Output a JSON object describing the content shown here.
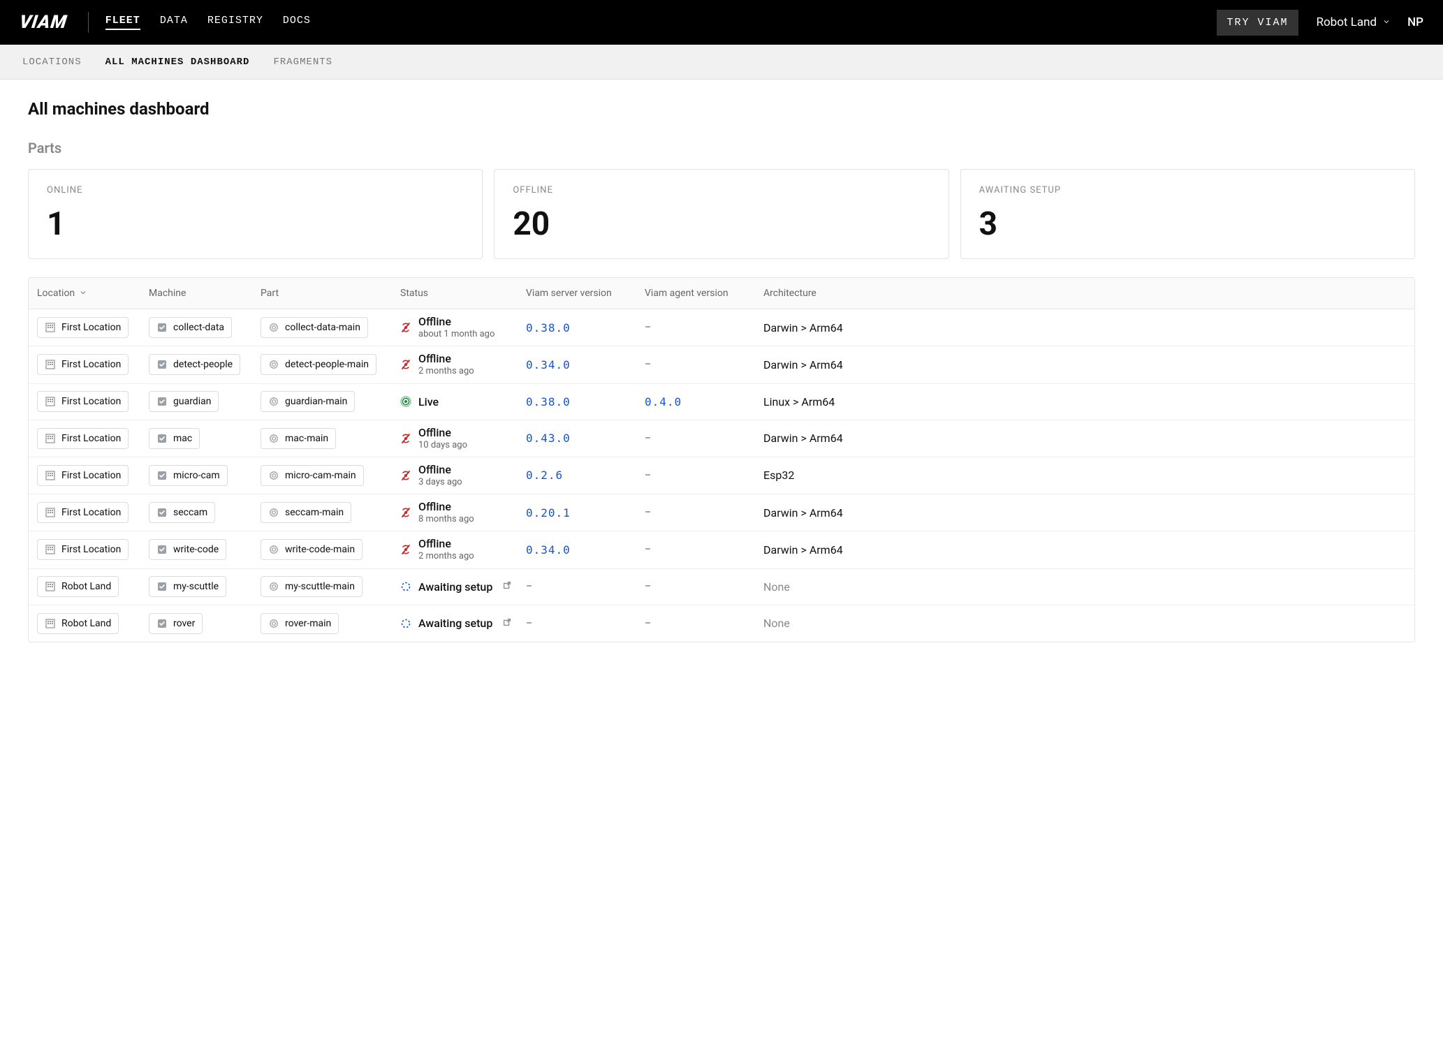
{
  "header": {
    "logo": "VIAM",
    "nav": {
      "fleet": "FLEET",
      "data": "DATA",
      "registry": "REGISTRY",
      "docs": "DOCS"
    },
    "try": "TRY VIAM",
    "org": "Robot Land",
    "user_initials": "NP"
  },
  "subnav": {
    "locations": "LOCATIONS",
    "all_machines": "ALL MACHINES DASHBOARD",
    "fragments": "FRAGMENTS"
  },
  "page": {
    "title": "All machines dashboard",
    "section": "Parts"
  },
  "stats": {
    "online_label": "ONLINE",
    "online_value": "1",
    "offline_label": "OFFLINE",
    "offline_value": "20",
    "awaiting_label": "AWAITING SETUP",
    "awaiting_value": "3"
  },
  "table": {
    "headers": {
      "location": "Location",
      "machine": "Machine",
      "part": "Part",
      "status": "Status",
      "server_ver": "Viam server version",
      "agent_ver": "Viam agent version",
      "arch": "Architecture"
    },
    "rows": [
      {
        "location": "First Location",
        "machine": "collect-data",
        "part": "collect-data-main",
        "status": "Offline",
        "status_sub": "about 1 month ago",
        "status_kind": "offline",
        "server_ver": "0.38.0",
        "agent_ver": "–",
        "arch": "Darwin > Arm64"
      },
      {
        "location": "First Location",
        "machine": "detect-people",
        "part": "detect-people-main",
        "status": "Offline",
        "status_sub": "2 months ago",
        "status_kind": "offline",
        "server_ver": "0.34.0",
        "agent_ver": "–",
        "arch": "Darwin > Arm64"
      },
      {
        "location": "First Location",
        "machine": "guardian",
        "part": "guardian-main",
        "status": "Live",
        "status_sub": "",
        "status_kind": "live",
        "server_ver": "0.38.0",
        "agent_ver": "0.4.0",
        "arch": "Linux > Arm64"
      },
      {
        "location": "First Location",
        "machine": "mac",
        "part": "mac-main",
        "status": "Offline",
        "status_sub": "10 days ago",
        "status_kind": "offline",
        "server_ver": "0.43.0",
        "agent_ver": "–",
        "arch": "Darwin > Arm64"
      },
      {
        "location": "First Location",
        "machine": "micro-cam",
        "part": "micro-cam-main",
        "status": "Offline",
        "status_sub": "3 days ago",
        "status_kind": "offline",
        "server_ver": "0.2.6",
        "agent_ver": "–",
        "arch": "Esp32"
      },
      {
        "location": "First Location",
        "machine": "seccam",
        "part": "seccam-main",
        "status": "Offline",
        "status_sub": "8 months ago",
        "status_kind": "offline",
        "server_ver": "0.20.1",
        "agent_ver": "–",
        "arch": "Darwin > Arm64"
      },
      {
        "location": "First Location",
        "machine": "write-code",
        "part": "write-code-main",
        "status": "Offline",
        "status_sub": "2 months ago",
        "status_kind": "offline",
        "server_ver": "0.34.0",
        "agent_ver": "–",
        "arch": "Darwin > Arm64"
      },
      {
        "location": "Robot Land",
        "machine": "my-scuttle",
        "part": "my-scuttle-main",
        "status": "Awaiting setup",
        "status_sub": "",
        "status_kind": "awaiting",
        "server_ver": "–",
        "agent_ver": "–",
        "arch": "None"
      },
      {
        "location": "Robot Land",
        "machine": "rover",
        "part": "rover-main",
        "status": "Awaiting setup",
        "status_sub": "",
        "status_kind": "awaiting",
        "server_ver": "–",
        "agent_ver": "–",
        "arch": "None"
      }
    ]
  }
}
